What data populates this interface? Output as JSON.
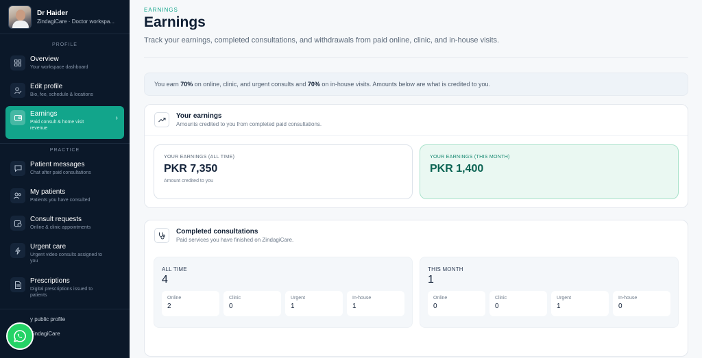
{
  "sidebar": {
    "user_name": "Dr Haider",
    "user_sub": "ZindagiCare · Doctor workspa...",
    "section_profile": "PROFILE",
    "section_practice": "PRACTICE",
    "items": [
      {
        "label": "Overview",
        "sub": "Your workspace dashboard",
        "icon": "grid-icon"
      },
      {
        "label": "Edit profile",
        "sub": "Bio, fee, schedule & locations",
        "icon": "user-edit-icon"
      },
      {
        "label": "Earnings",
        "sub": "Paid consult & home visit revenue",
        "icon": "wallet-icon"
      },
      {
        "label": "Patient messages",
        "sub": "Chat after paid consultations",
        "icon": "chat-icon"
      },
      {
        "label": "My patients",
        "sub": "Patients you have consulted",
        "icon": "users-icon"
      },
      {
        "label": "Consult requests",
        "sub": "Online & clinic appointments",
        "icon": "calendar-clock-icon"
      },
      {
        "label": "Urgent care",
        "sub": "Urgent video consults assigned to you",
        "icon": "bolt-icon"
      },
      {
        "label": "Prescriptions",
        "sub": "Digital prescriptions issued to patients",
        "icon": "document-icon"
      }
    ],
    "footer_public_profile": "y public profile",
    "footer_brand": "ZindagiCare"
  },
  "header": {
    "eyebrow": "EARNINGS",
    "title": "Earnings",
    "description": "Track your earnings, completed consultations, and withdrawals from paid online, clinic, and in-house visits."
  },
  "notice": {
    "prefix": "You earn ",
    "pct1": "70%",
    "middle": " on online, clinic, and urgent consults and ",
    "pct2": "70%",
    "suffix": " on in-house visits. Amounts below are what is credited to you."
  },
  "earnings_card": {
    "title": "Your earnings",
    "subtitle": "Amounts credited to you from completed paid consultations.",
    "all_time_label": "YOUR EARNINGS (ALL TIME)",
    "all_time_value": "PKR 7,350",
    "all_time_note": "Amount credited to you",
    "month_label": "YOUR EARNINGS (THIS MONTH)",
    "month_value": "PKR 1,400"
  },
  "consultations_card": {
    "title": "Completed consultations",
    "subtitle": "Paid services you have finished on ZindagiCare.",
    "all_time": {
      "label": "ALL TIME",
      "total": "4",
      "breakdown": [
        {
          "name": "Online",
          "value": "2"
        },
        {
          "name": "Clinic",
          "value": "0"
        },
        {
          "name": "Urgent",
          "value": "1"
        },
        {
          "name": "In-house",
          "value": "1"
        }
      ]
    },
    "this_month": {
      "label": "THIS MONTH",
      "total": "1",
      "breakdown": [
        {
          "name": "Online",
          "value": "0"
        },
        {
          "name": "Clinic",
          "value": "0"
        },
        {
          "name": "Urgent",
          "value": "1"
        },
        {
          "name": "In-house",
          "value": "0"
        }
      ]
    }
  },
  "colors": {
    "sidebar_bg": "#0b1829",
    "accent": "#12a58b",
    "whatsapp": "#25d366"
  }
}
